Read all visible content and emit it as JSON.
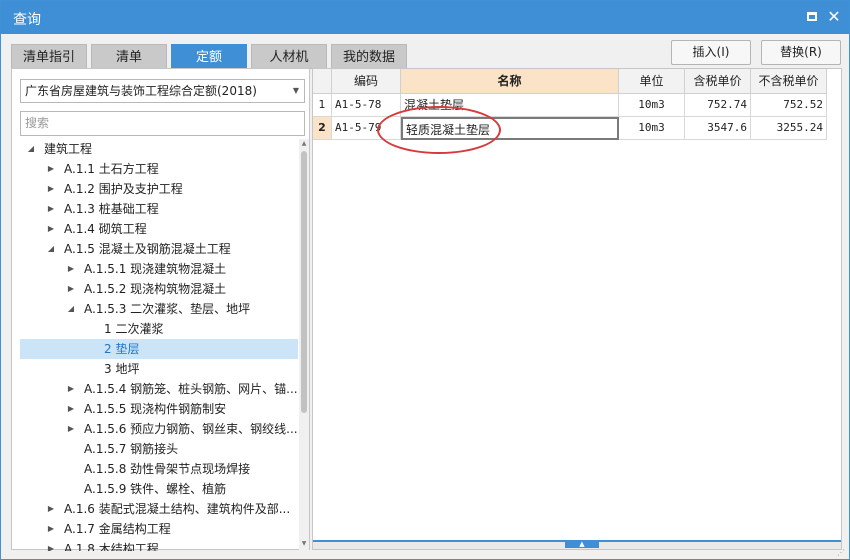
{
  "window": {
    "title": "查询"
  },
  "tabs": [
    {
      "label": "清单指引",
      "active": false
    },
    {
      "label": "清单",
      "active": false
    },
    {
      "label": "定额",
      "active": true
    },
    {
      "label": "人材机",
      "active": false
    },
    {
      "label": "我的数据",
      "active": false
    }
  ],
  "actions": {
    "insert_label": "插入(I)",
    "replace_label": "替换(R)"
  },
  "left": {
    "dropdown_value": "广东省房屋建筑与装饰工程综合定额(2018)",
    "search_placeholder": "搜索"
  },
  "tree": [
    {
      "label": "建筑工程",
      "level": 0,
      "arrow": "open"
    },
    {
      "label": "A.1.1 土石方工程",
      "level": 1,
      "arrow": "closed"
    },
    {
      "label": "A.1.2 围护及支护工程",
      "level": 1,
      "arrow": "closed"
    },
    {
      "label": "A.1.3 桩基础工程",
      "level": 1,
      "arrow": "closed"
    },
    {
      "label": "A.1.4 砌筑工程",
      "level": 1,
      "arrow": "closed"
    },
    {
      "label": "A.1.5 混凝土及钢筋混凝土工程",
      "level": 1,
      "arrow": "open"
    },
    {
      "label": "A.1.5.1 现浇建筑物混凝土",
      "level": 2,
      "arrow": "closed"
    },
    {
      "label": "A.1.5.2 现浇构筑物混凝土",
      "level": 2,
      "arrow": "closed"
    },
    {
      "label": "A.1.5.3 二次灌浆、垫层、地坪",
      "level": 2,
      "arrow": "open"
    },
    {
      "label": "1 二次灌浆",
      "level": 3,
      "arrow": "none"
    },
    {
      "label": "2 垫层",
      "level": 3,
      "arrow": "none",
      "selected": true
    },
    {
      "label": "3 地坪",
      "level": 3,
      "arrow": "none"
    },
    {
      "label": "A.1.5.4 钢筋笼、桩头钢筋、网片、锚...",
      "level": 2,
      "arrow": "closed"
    },
    {
      "label": "A.1.5.5 现浇构件钢筋制安",
      "level": 2,
      "arrow": "closed"
    },
    {
      "label": "A.1.5.6 预应力钢筋、钢丝束、钢绞线...",
      "level": 2,
      "arrow": "closed"
    },
    {
      "label": "A.1.5.7 钢筋接头",
      "level": 2,
      "arrow": "none"
    },
    {
      "label": "A.1.5.8 劲性骨架节点现场焊接",
      "level": 2,
      "arrow": "none"
    },
    {
      "label": "A.1.5.9 铁件、螺栓、植筋",
      "level": 2,
      "arrow": "none"
    },
    {
      "label": "A.1.6 装配式混凝土结构、建筑构件及部...",
      "level": 1,
      "arrow": "closed"
    },
    {
      "label": "A.1.7 金属结构工程",
      "level": 1,
      "arrow": "closed"
    },
    {
      "label": "A.1.8 木结构工程",
      "level": 1,
      "arrow": "closed"
    }
  ],
  "grid": {
    "headers": {
      "code": "编码",
      "name": "名称",
      "unit": "单位",
      "tax_price": "含税单价",
      "notax_price": "不含税单价"
    },
    "rows": [
      {
        "no": "1",
        "code": "A1-5-78",
        "name": "混凝土垫层",
        "unit": "10m3",
        "tax_price": "752.74",
        "notax_price": "752.52"
      },
      {
        "no": "2",
        "code": "A1-5-79",
        "name": "轻质混凝土垫层",
        "unit": "10m3",
        "tax_price": "3547.6",
        "notax_price": "3255.24"
      }
    ]
  }
}
